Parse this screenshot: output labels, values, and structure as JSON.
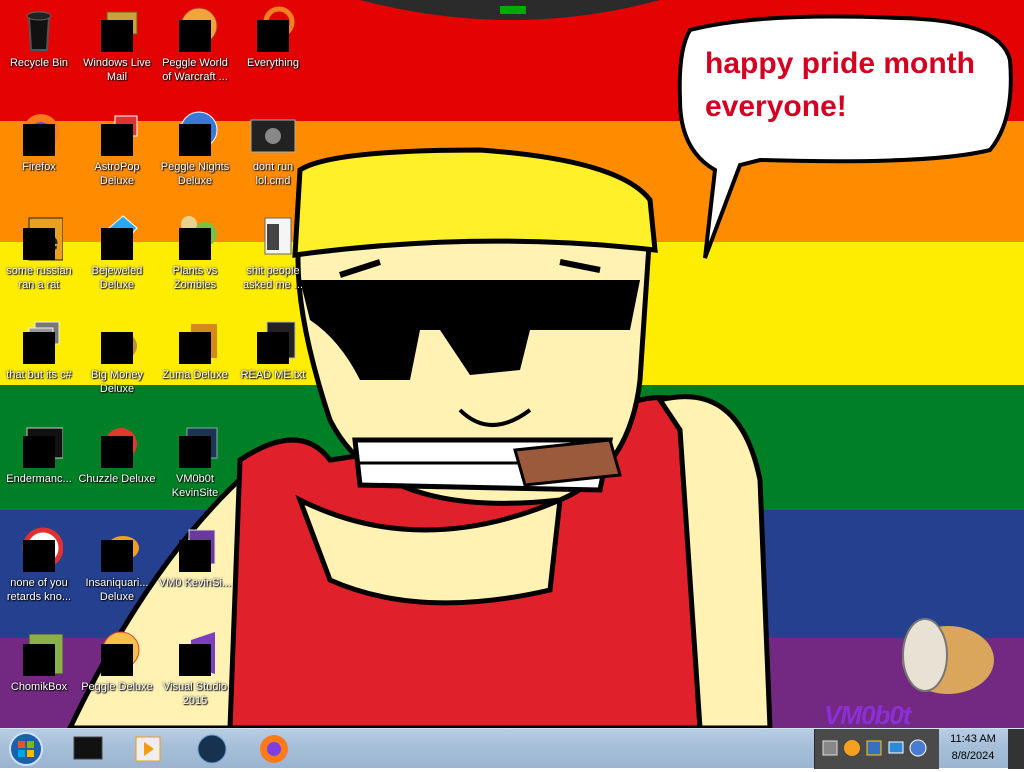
{
  "desktop": {
    "flag_colors": [
      "#e40303",
      "#ff8c00",
      "#ffed00",
      "#008026",
      "#24408e",
      "#732982"
    ],
    "speech_bubble": {
      "line1": "happy pride month",
      "line2": "everyone!"
    },
    "watermark": "VM0b0t",
    "icons": [
      {
        "label": "Recycle Bin",
        "icon": "recycle-bin-icon"
      },
      {
        "label": "Windows Live Mail",
        "icon": "mail-icon"
      },
      {
        "label": "Peggle World of Warcraft ...",
        "icon": "peggle-wow-icon"
      },
      {
        "label": "Everything",
        "icon": "everything-search-icon"
      },
      {
        "label": "Firefox",
        "icon": "firefox-icon"
      },
      {
        "label": "AstroPop Deluxe",
        "icon": "astropop-icon"
      },
      {
        "label": "Peggle Nights Deluxe",
        "icon": "peggle-nights-icon"
      },
      {
        "label": "dont run lol.cmd",
        "icon": "cmd-script-icon"
      },
      {
        "label": "some russian ran a rat",
        "icon": "java-file-icon"
      },
      {
        "label": "Bejeweled Deluxe",
        "icon": "bejeweled-icon"
      },
      {
        "label": "Plants vs Zombies",
        "icon": "pvz-icon"
      },
      {
        "label": "shit people asked me ...",
        "icon": "text-file-icon"
      },
      {
        "label": "that but its c#",
        "icon": "stacked-files-icon"
      },
      {
        "label": "Big Money Deluxe",
        "icon": "money-bag-icon"
      },
      {
        "label": "Zuma Deluxe",
        "icon": "zuma-icon"
      },
      {
        "label": "READ ME.txt",
        "icon": "readme-file-icon"
      },
      {
        "label": "Endermanc...",
        "icon": "terminal-icon"
      },
      {
        "label": "Chuzzle Deluxe",
        "icon": "chuzzle-icon"
      },
      {
        "label": "VM0b0t KevinSite",
        "icon": "kevinsite-icon"
      },
      {
        "label": "none of you retards kno...",
        "icon": "opera-icon"
      },
      {
        "label": "Insaniquari... Deluxe",
        "icon": "insaniquarium-icon"
      },
      {
        "label": "VM0 KevinSi...",
        "icon": "kevinsite-doc-icon"
      },
      {
        "label": "ChomikBox",
        "icon": "chomikbox-icon"
      },
      {
        "label": "Peggle Deluxe",
        "icon": "peggle-icon"
      },
      {
        "label": "Visual Studio 2015",
        "icon": "visual-studio-icon"
      }
    ]
  },
  "taskbar": {
    "start": "start-orb-icon",
    "pinned": [
      {
        "name": "command-prompt-icon"
      },
      {
        "name": "media-player-icon"
      },
      {
        "name": "globe-browser-icon"
      },
      {
        "name": "firefox-icon"
      }
    ],
    "tray_icons": [
      "network-icon",
      "peggle-tray-icon",
      "volume-icon",
      "display-icon",
      "clock-tray-icon"
    ],
    "clock": {
      "time": "11:43 AM",
      "date": "8/8/2024"
    }
  }
}
